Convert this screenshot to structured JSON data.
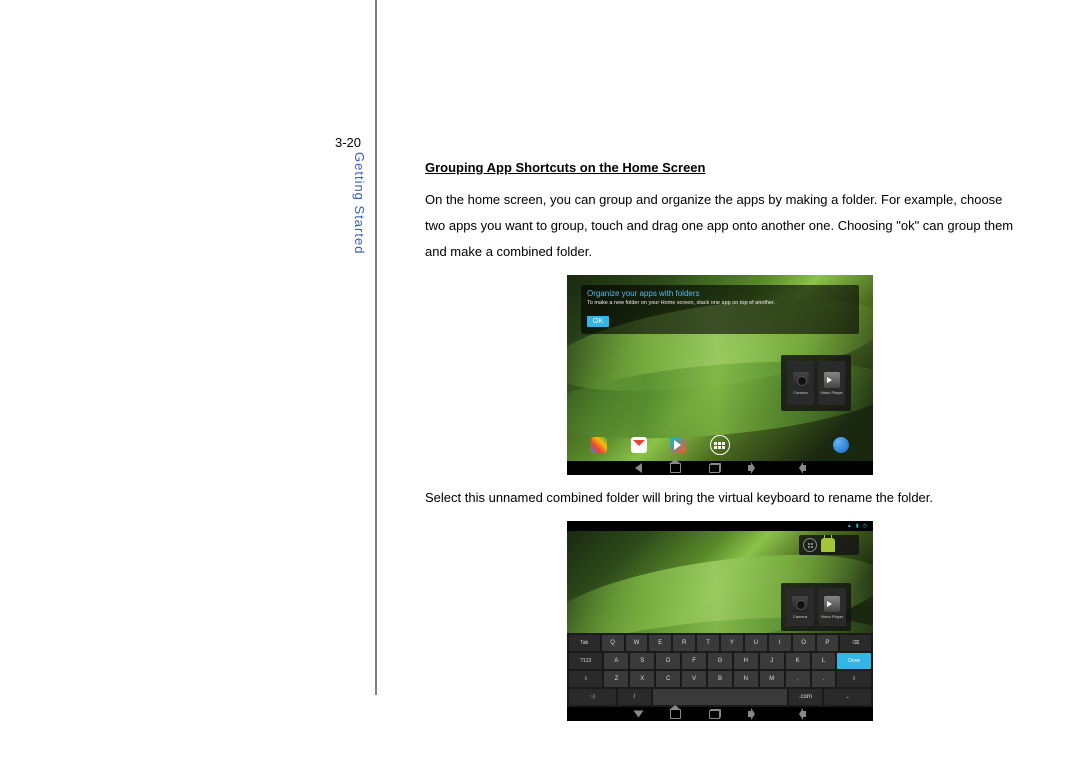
{
  "page_number": "3-20",
  "section_label": "Getting Started",
  "heading": "Grouping App Shortcuts on the Home Screen",
  "para1": "On the home screen, you can group and organize the apps by making a folder. For example, choose two apps you want to group, touch and drag one app onto another one. Choosing \"ok\" can group them and make a combined folder.",
  "para2": "Select this unnamed combined folder will bring the virtual keyboard to rename the folder.",
  "screenshot1": {
    "dialog_title": "Organize your apps with folders",
    "dialog_sub": "To make a new folder on your Home screen, stack one app on top of another.",
    "ok": "OK",
    "app1": "Camera",
    "app2": "Video Player"
  },
  "screenshot2": {
    "app1": "Camera",
    "app2": "Video Player",
    "keyboard": {
      "row1_label": "Tab",
      "row1": [
        "Q",
        "W",
        "E",
        "R",
        "T",
        "Y",
        "U",
        "I",
        "O",
        "P"
      ],
      "row1_end": "⌫",
      "row2_label": "?123",
      "row2": [
        "A",
        "S",
        "D",
        "F",
        "G",
        "H",
        "J",
        "K",
        "L"
      ],
      "row2_end": "Done",
      "row3_label": "⇧",
      "row3": [
        "Z",
        "X",
        "C",
        "V",
        "B",
        "N",
        "M",
        ",",
        "."
      ],
      "row3_end": "⇧",
      "row4_left": ":-)",
      "row4_slash": "/",
      "row4_com": ".com",
      "row4_right": "⌄"
    }
  }
}
